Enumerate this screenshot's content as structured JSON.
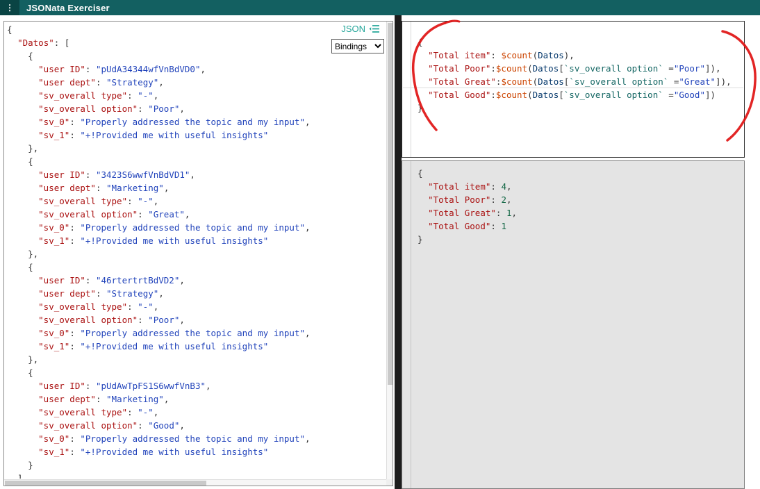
{
  "header": {
    "title": "JSONata Exerciser",
    "logo_glyph": "⋮"
  },
  "left_editor": {
    "tab_label": "JSON",
    "bindings_label": "Bindings",
    "lines": [
      [
        [
          "pl",
          "{"
        ]
      ],
      [
        [
          "pl",
          "  "
        ],
        [
          "key",
          "\"Datos\""
        ],
        [
          "pl",
          ": ["
        ]
      ],
      [
        [
          "pl",
          "    {"
        ]
      ],
      [
        [
          "pl",
          "      "
        ],
        [
          "key",
          "\"user ID\""
        ],
        [
          "pl",
          ": "
        ],
        [
          "str",
          "\"pUdA34344wfVnBdVD0\""
        ],
        [
          "pl",
          ","
        ]
      ],
      [
        [
          "pl",
          "      "
        ],
        [
          "key",
          "\"user dept\""
        ],
        [
          "pl",
          ": "
        ],
        [
          "str",
          "\"Strategy\""
        ],
        [
          "pl",
          ","
        ]
      ],
      [
        [
          "pl",
          "      "
        ],
        [
          "key",
          "\"sv_overall type\""
        ],
        [
          "pl",
          ": "
        ],
        [
          "str",
          "\"-\""
        ],
        [
          "pl",
          ","
        ]
      ],
      [
        [
          "pl",
          "      "
        ],
        [
          "key",
          "\"sv_overall option\""
        ],
        [
          "pl",
          ": "
        ],
        [
          "str",
          "\"Poor\""
        ],
        [
          "pl",
          ","
        ]
      ],
      [
        [
          "pl",
          "      "
        ],
        [
          "key",
          "\"sv_0\""
        ],
        [
          "pl",
          ": "
        ],
        [
          "str",
          "\"Properly addressed the topic and my input\""
        ],
        [
          "pl",
          ","
        ]
      ],
      [
        [
          "pl",
          "      "
        ],
        [
          "key",
          "\"sv_1\""
        ],
        [
          "pl",
          ": "
        ],
        [
          "str",
          "\"+!Provided me with useful insights\""
        ]
      ],
      [
        [
          "pl",
          "    },"
        ]
      ],
      [
        [
          "pl",
          "    {"
        ]
      ],
      [
        [
          "pl",
          "      "
        ],
        [
          "key",
          "\"user ID\""
        ],
        [
          "pl",
          ": "
        ],
        [
          "str",
          "\"3423S6wwfVnBdVD1\""
        ],
        [
          "pl",
          ","
        ]
      ],
      [
        [
          "pl",
          "      "
        ],
        [
          "key",
          "\"user dept\""
        ],
        [
          "pl",
          ": "
        ],
        [
          "str",
          "\"Marketing\""
        ],
        [
          "pl",
          ","
        ]
      ],
      [
        [
          "pl",
          "      "
        ],
        [
          "key",
          "\"sv_overall type\""
        ],
        [
          "pl",
          ": "
        ],
        [
          "str",
          "\"-\""
        ],
        [
          "pl",
          ","
        ]
      ],
      [
        [
          "pl",
          "      "
        ],
        [
          "key",
          "\"sv_overall option\""
        ],
        [
          "pl",
          ": "
        ],
        [
          "str",
          "\"Great\""
        ],
        [
          "pl",
          ","
        ]
      ],
      [
        [
          "pl",
          "      "
        ],
        [
          "key",
          "\"sv_0\""
        ],
        [
          "pl",
          ": "
        ],
        [
          "str",
          "\"Properly addressed the topic and my input\""
        ],
        [
          "pl",
          ","
        ]
      ],
      [
        [
          "pl",
          "      "
        ],
        [
          "key",
          "\"sv_1\""
        ],
        [
          "pl",
          ": "
        ],
        [
          "str",
          "\"+!Provided me with useful insights\""
        ]
      ],
      [
        [
          "pl",
          "    },"
        ]
      ],
      [
        [
          "pl",
          "    {"
        ]
      ],
      [
        [
          "pl",
          "      "
        ],
        [
          "key",
          "\"user ID\""
        ],
        [
          "pl",
          ": "
        ],
        [
          "str",
          "\"46rtertrtBdVD2\""
        ],
        [
          "pl",
          ","
        ]
      ],
      [
        [
          "pl",
          "      "
        ],
        [
          "key",
          "\"user dept\""
        ],
        [
          "pl",
          ": "
        ],
        [
          "str",
          "\"Strategy\""
        ],
        [
          "pl",
          ","
        ]
      ],
      [
        [
          "pl",
          "      "
        ],
        [
          "key",
          "\"sv_overall type\""
        ],
        [
          "pl",
          ": "
        ],
        [
          "str",
          "\"-\""
        ],
        [
          "pl",
          ","
        ]
      ],
      [
        [
          "pl",
          "      "
        ],
        [
          "key",
          "\"sv_overall option\""
        ],
        [
          "pl",
          ": "
        ],
        [
          "str",
          "\"Poor\""
        ],
        [
          "pl",
          ","
        ]
      ],
      [
        [
          "pl",
          "      "
        ],
        [
          "key",
          "\"sv_0\""
        ],
        [
          "pl",
          ": "
        ],
        [
          "str",
          "\"Properly addressed the topic and my input\""
        ],
        [
          "pl",
          ","
        ]
      ],
      [
        [
          "pl",
          "      "
        ],
        [
          "key",
          "\"sv_1\""
        ],
        [
          "pl",
          ": "
        ],
        [
          "str",
          "\"+!Provided me with useful insights\""
        ]
      ],
      [
        [
          "pl",
          "    },"
        ]
      ],
      [
        [
          "pl",
          "    {"
        ]
      ],
      [
        [
          "pl",
          "      "
        ],
        [
          "key",
          "\"user ID\""
        ],
        [
          "pl",
          ": "
        ],
        [
          "str",
          "\"pUdAwTpFS1S6wwfVnB3\""
        ],
        [
          "pl",
          ","
        ]
      ],
      [
        [
          "pl",
          "      "
        ],
        [
          "key",
          "\"user dept\""
        ],
        [
          "pl",
          ": "
        ],
        [
          "str",
          "\"Marketing\""
        ],
        [
          "pl",
          ","
        ]
      ],
      [
        [
          "pl",
          "      "
        ],
        [
          "key",
          "\"sv_overall type\""
        ],
        [
          "pl",
          ": "
        ],
        [
          "str",
          "\"-\""
        ],
        [
          "pl",
          ","
        ]
      ],
      [
        [
          "pl",
          "      "
        ],
        [
          "key",
          "\"sv_overall option\""
        ],
        [
          "pl",
          ": "
        ],
        [
          "str",
          "\"Good\""
        ],
        [
          "pl",
          ","
        ]
      ],
      [
        [
          "pl",
          "      "
        ],
        [
          "key",
          "\"sv_0\""
        ],
        [
          "pl",
          ": "
        ],
        [
          "str",
          "\"Properly addressed the topic and my input\""
        ],
        [
          "pl",
          ","
        ]
      ],
      [
        [
          "pl",
          "      "
        ],
        [
          "key",
          "\"sv_1\""
        ],
        [
          "pl",
          ": "
        ],
        [
          "str",
          "\"+!Provided me with useful insights\""
        ]
      ],
      [
        [
          "pl",
          "    }"
        ]
      ],
      [
        [
          "pl",
          "  ]"
        ]
      ]
    ]
  },
  "expression_editor": {
    "lines": [
      [
        [
          "pl",
          "{"
        ]
      ],
      [
        [
          "pl",
          "  "
        ],
        [
          "key",
          "\"Total item\""
        ],
        [
          "pl",
          ": "
        ],
        [
          "fn",
          "$count"
        ],
        [
          "pl",
          "("
        ],
        [
          "var",
          "Datos"
        ],
        [
          "pl",
          "),"
        ]
      ],
      [
        [
          "pl",
          "  "
        ],
        [
          "key",
          "\"Total Poor\""
        ],
        [
          "pl",
          ":"
        ],
        [
          "fn",
          "$count"
        ],
        [
          "pl",
          "("
        ],
        [
          "var",
          "Datos"
        ],
        [
          "pl",
          "["
        ],
        [
          "name",
          "`sv_overall option`"
        ],
        [
          "pl",
          " ="
        ],
        [
          "str",
          "\"Poor\""
        ],
        [
          "pl",
          "]),"
        ]
      ],
      [
        [
          "pl",
          "  "
        ],
        [
          "key",
          "\"Total Great\""
        ],
        [
          "pl",
          ":"
        ],
        [
          "fn",
          "$count"
        ],
        [
          "pl",
          "("
        ],
        [
          "var",
          "Datos"
        ],
        [
          "pl",
          "["
        ],
        [
          "name",
          "`sv_overall option`"
        ],
        [
          "pl",
          " ="
        ],
        [
          "str",
          "\"Great\""
        ],
        [
          "pl",
          "]),"
        ]
      ],
      [
        [
          "pl",
          "  "
        ],
        [
          "key",
          "\"Total Good\""
        ],
        [
          "pl",
          ":"
        ],
        [
          "fn",
          "$count"
        ],
        [
          "pl",
          "("
        ],
        [
          "var",
          "Datos"
        ],
        [
          "pl",
          "["
        ],
        [
          "name",
          "`sv_overall option`"
        ],
        [
          "pl",
          " ="
        ],
        [
          "str",
          "\"Good\""
        ],
        [
          "pl",
          "])"
        ]
      ],
      [
        [
          "pl",
          "}"
        ]
      ]
    ]
  },
  "results_editor": {
    "lines": [
      [
        [
          "pl",
          "{"
        ]
      ],
      [
        [
          "pl",
          "  "
        ],
        [
          "key",
          "\"Total item\""
        ],
        [
          "pl",
          ": "
        ],
        [
          "num",
          "4"
        ],
        [
          "pl",
          ","
        ]
      ],
      [
        [
          "pl",
          "  "
        ],
        [
          "key",
          "\"Total Poor\""
        ],
        [
          "pl",
          ": "
        ],
        [
          "num",
          "2"
        ],
        [
          "pl",
          ","
        ]
      ],
      [
        [
          "pl",
          "  "
        ],
        [
          "key",
          "\"Total Great\""
        ],
        [
          "pl",
          ": "
        ],
        [
          "num",
          "1"
        ],
        [
          "pl",
          ","
        ]
      ],
      [
        [
          "pl",
          "  "
        ],
        [
          "key",
          "\"Total Good\""
        ],
        [
          "pl",
          ": "
        ],
        [
          "num",
          "1"
        ]
      ],
      [
        [
          "pl",
          "}"
        ]
      ]
    ]
  },
  "colors": {
    "header_bg": "#136061",
    "logo_bg": "#0a4444",
    "accent": "#26a69a",
    "key": "#aa1111",
    "str": "#2244bb",
    "num": "#116644",
    "fn": "#cc4400",
    "var": "#05386b",
    "name": "#156764",
    "pl": "#333333",
    "annotation": "#e01212"
  }
}
